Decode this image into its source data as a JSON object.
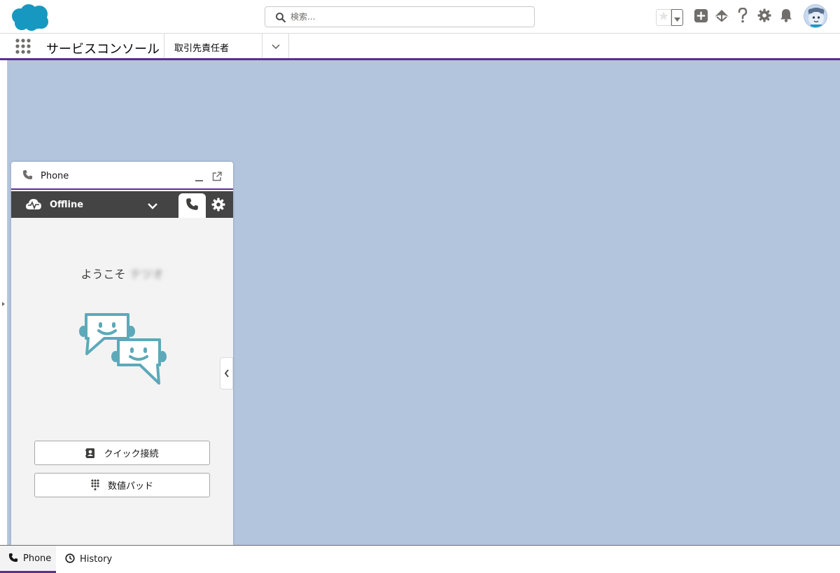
{
  "header": {
    "logo": "salesforce-cloud-logo",
    "search": {
      "placeholder": "検索...",
      "value": ""
    },
    "icons": [
      "star-icon",
      "chevron-down-icon",
      "add-icon",
      "trailhead-icon",
      "help-icon",
      "setup-gear-icon",
      "bell-icon",
      "avatar"
    ]
  },
  "nav": {
    "app_name": "サービスコンソール",
    "item_label": "取引先責任者"
  },
  "phone_panel": {
    "title": "Phone",
    "status": "Offline",
    "welcome_text": "ようこそ",
    "welcome_name": "テツオ",
    "buttons": {
      "quick_connect": "クイック接続",
      "number_pad": "数値パッド"
    }
  },
  "utility_bar": {
    "phone_label": "Phone",
    "history_label": "History"
  },
  "colors": {
    "brand_purple": "#5b2e91",
    "salesforce_blue": "#1798c1",
    "workspace_bg": "#b3c4dd",
    "status_bar_bg": "#444444",
    "illustration_teal": "#5da9ba"
  }
}
